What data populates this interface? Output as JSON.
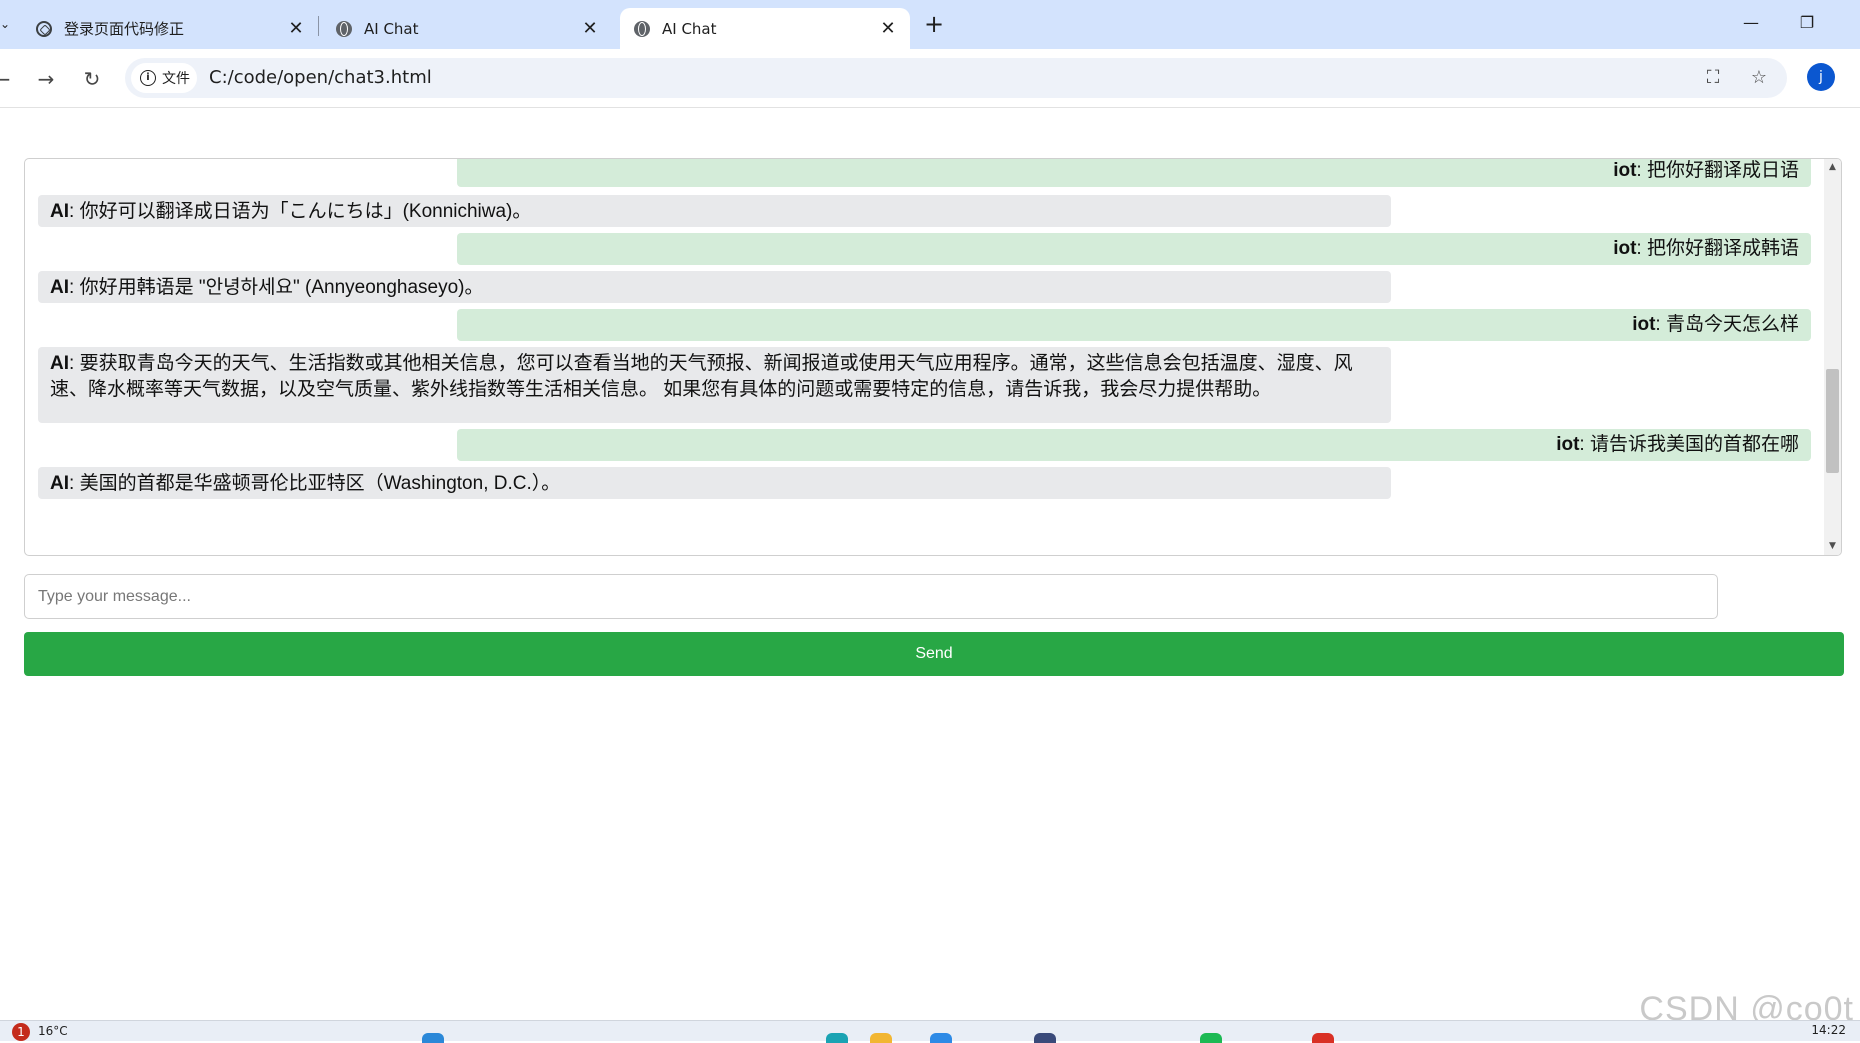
{
  "browser": {
    "tabs": [
      {
        "title": "登录页面代码修正",
        "icon": "chatgpt-icon",
        "active": false
      },
      {
        "title": "AI Chat",
        "icon": "globe-icon",
        "active": false
      },
      {
        "title": "AI Chat",
        "icon": "globe-icon",
        "active": true
      }
    ],
    "new_tab_symbol": "+",
    "close_symbol": "✕",
    "window_controls": {
      "minimize": "—",
      "restore": "❐",
      "close": "✕"
    },
    "address": {
      "site_chip_label": "文件",
      "url": "C:/code/open/chat3.html"
    },
    "profile_initial": "j"
  },
  "chat": {
    "messages": [
      {
        "role": "user",
        "sender": "iot",
        "text": "把你好翻译成日语"
      },
      {
        "role": "ai",
        "sender": "AI",
        "text": "你好可以翻译成日语为「こんにちは」(Konnichiwa)。"
      },
      {
        "role": "user",
        "sender": "iot",
        "text": "把你好翻译成韩语"
      },
      {
        "role": "ai",
        "sender": "AI",
        "text": "你好用韩语是 \"안녕하세요\" (Annyeonghaseyo)。"
      },
      {
        "role": "user",
        "sender": "iot",
        "text": "青岛今天怎么样"
      },
      {
        "role": "ai",
        "sender": "AI",
        "text": "要获取青岛今天的天气、生活指数或其他相关信息，您可以查看当地的天气预报、新闻报道或使用天气应用程序。通常，这些信息会包括温度、湿度、风速、降水概率等天气数据，以及空气质量、紫外线指数等生活相关信息。 如果您有具体的问题或需要特定的信息，请告诉我，我会尽力提供帮助。"
      },
      {
        "role": "user",
        "sender": "iot",
        "text": "请告诉我美国的首都在哪"
      },
      {
        "role": "ai",
        "sender": "AI",
        "text": "美国的首都是华盛顿哥伦比亚特区（Washington, D.C.）。"
      }
    ],
    "input_placeholder": "Type your message...",
    "input_value": "",
    "send_label": "Send",
    "colors": {
      "user_bubble": "#d4ecd9",
      "ai_bubble": "#e8e9eb",
      "send_button": "#28a745"
    }
  },
  "watermark": "CSDN @co0t",
  "taskbar": {
    "weather_badge": "1",
    "temperature": "16°C",
    "clock": "14:22"
  }
}
